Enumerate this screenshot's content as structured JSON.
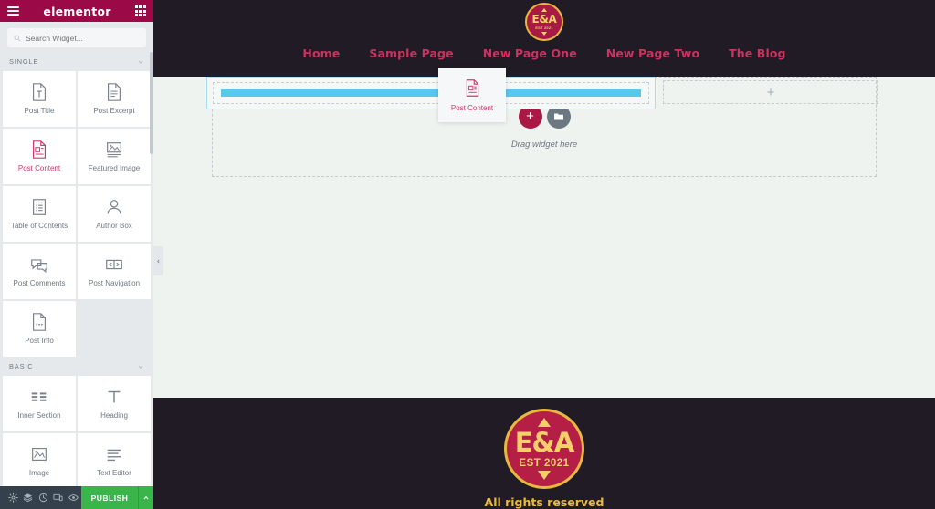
{
  "panel": {
    "logo_text": "elementor",
    "menu_icon": "hamburger-icon",
    "apps_icon": "grid-apps-icon",
    "search": {
      "placeholder": "Search Widget...",
      "value": "",
      "icon": "search-icon"
    },
    "categories": [
      {
        "id": "single",
        "label": "SINGLE",
        "collapse_icon": "chevron-down-icon",
        "widgets": [
          {
            "label": "Post Title",
            "icon": "post-title-icon",
            "active": false
          },
          {
            "label": "Post Excerpt",
            "icon": "post-excerpt-icon",
            "active": false
          },
          {
            "label": "Post Content",
            "icon": "post-content-icon",
            "active": true
          },
          {
            "label": "Featured Image",
            "icon": "featured-image-icon",
            "active": false
          },
          {
            "label": "Table of Contents",
            "icon": "table-of-contents-icon",
            "active": false
          },
          {
            "label": "Author Box",
            "icon": "author-box-icon",
            "active": false
          },
          {
            "label": "Post Comments",
            "icon": "post-comments-icon",
            "active": false
          },
          {
            "label": "Post Navigation",
            "icon": "post-navigation-icon",
            "active": false
          },
          {
            "label": "Post Info",
            "icon": "post-info-icon",
            "active": false
          }
        ]
      },
      {
        "id": "basic",
        "label": "BASIC",
        "collapse_icon": "chevron-down-icon",
        "widgets": [
          {
            "label": "Inner Section",
            "icon": "inner-section-icon",
            "active": false
          },
          {
            "label": "Heading",
            "icon": "heading-icon",
            "active": false
          },
          {
            "label": "Image",
            "icon": "image-icon",
            "active": false
          },
          {
            "label": "Text Editor",
            "icon": "text-editor-icon",
            "active": false
          }
        ]
      }
    ],
    "footer_toolbar": {
      "icons": [
        {
          "name": "settings-gear-icon",
          "title": "Settings"
        },
        {
          "name": "navigator-layers-icon",
          "title": "Navigator"
        },
        {
          "name": "history-clock-icon",
          "title": "History"
        },
        {
          "name": "responsive-mode-icon",
          "title": "Responsive Mode"
        },
        {
          "name": "preview-eye-icon",
          "title": "Preview Changes"
        }
      ],
      "publish_label": "PUBLISH",
      "publish_caret_icon": "chevron-up-icon",
      "publish_color": "#39b54a"
    }
  },
  "canvas": {
    "site_header": {
      "logo": {
        "monogram": "E&A",
        "established": "EST 2021"
      },
      "nav": [
        {
          "label": "Home"
        },
        {
          "label": "Sample Page"
        },
        {
          "label": "New Page One"
        },
        {
          "label": "New Page Two"
        },
        {
          "label": "The Blog"
        }
      ],
      "bg_color": "#211b26",
      "nav_link_color": "#c8335f"
    },
    "drop_section": {
      "indicator_color": "#59c6ee",
      "border_color": "#a8dff5"
    },
    "right_column": {
      "add_icon": "plus-icon"
    },
    "empty_section": {
      "add_widget_icon": "plus-icon",
      "add_template_icon": "folder-template-icon",
      "hint": "Drag widget here",
      "add_color": "#a81a45"
    },
    "collapse_tab": {
      "icon": "chevron-left-icon"
    },
    "site_footer": {
      "logo": {
        "monogram": "E&A",
        "established": "EST 2021"
      },
      "copyright": "All rights reserved",
      "bg_color": "#211b26",
      "text_color": "#e8b93f"
    }
  },
  "drag_ghost": {
    "label": "Post Content",
    "icon": "post-content-icon"
  }
}
